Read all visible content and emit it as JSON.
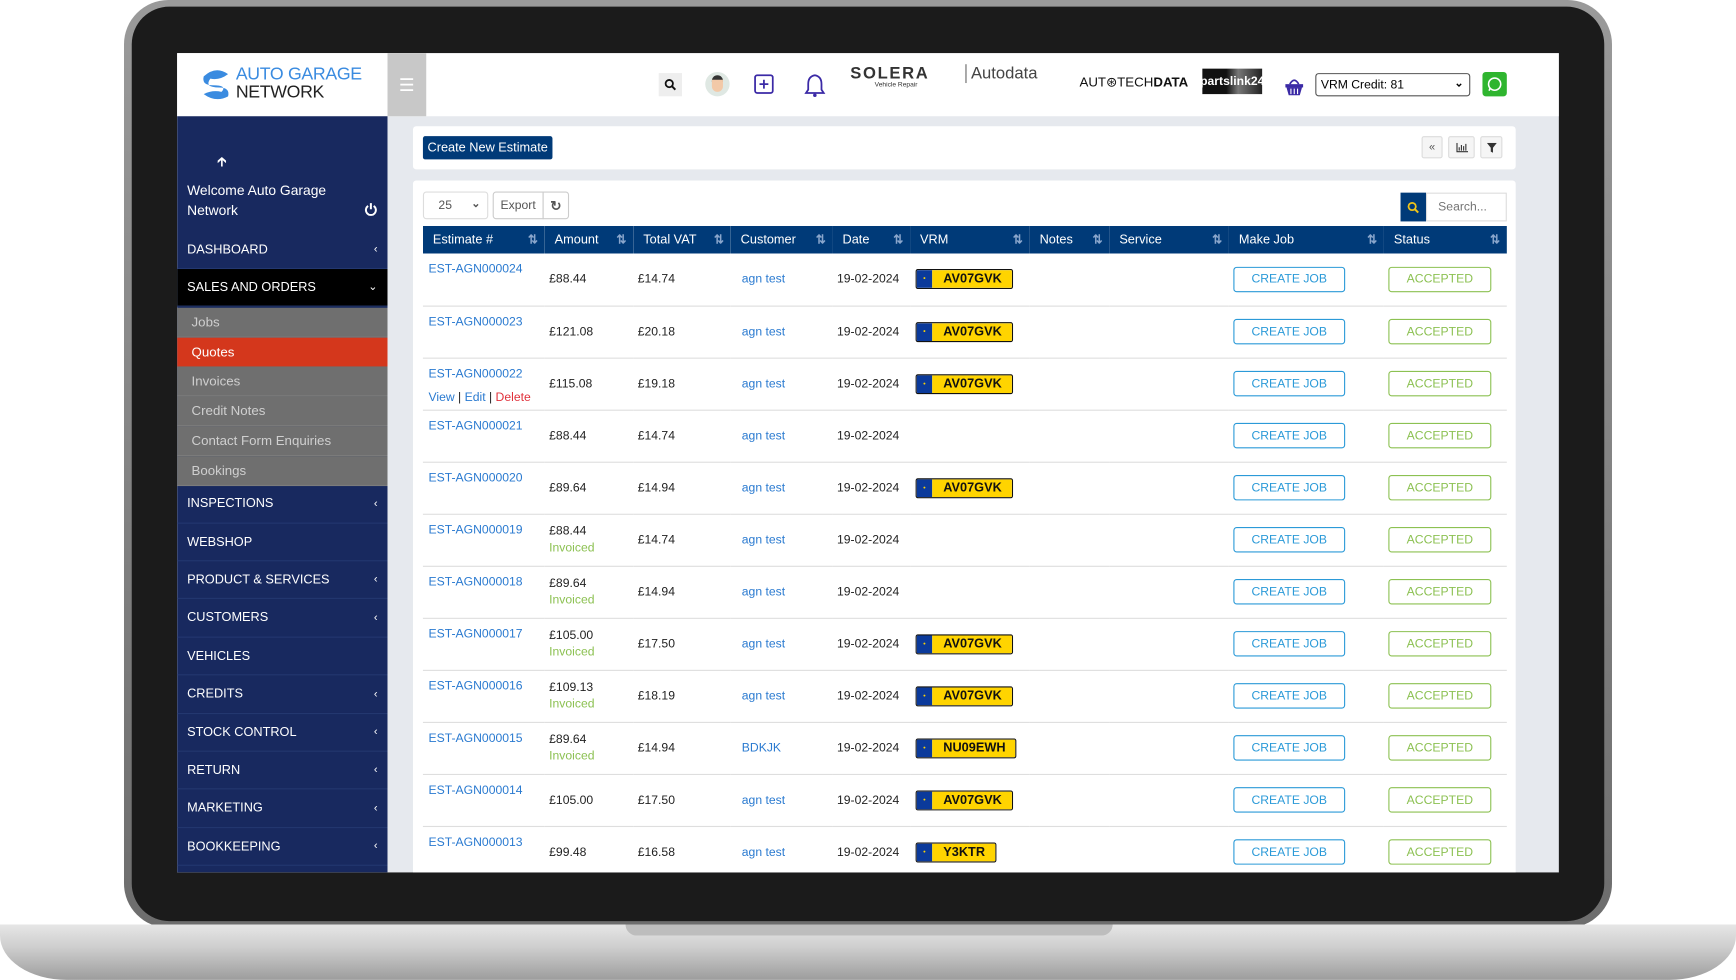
{
  "header": {
    "logo_line1": "AUTO GARAGE",
    "logo_line2": "NETWORK",
    "partners": [
      "SOLERA",
      "Vehicle Repair",
      "Autodata",
      "AUT⊛TECH",
      "DATA",
      "partslink24"
    ],
    "vrm_credit": "VRM Credit: 81",
    "icons": [
      "menu-icon",
      "search-icon",
      "avatar",
      "plus-square-icon",
      "bell-icon",
      "basket-icon",
      "whatsapp-icon"
    ],
    "colors": {
      "brand": "#003a78",
      "whatsapp": "#2fb52f"
    }
  },
  "sidebar": {
    "welcome": "Welcome Auto Garage Network",
    "items": [
      {
        "label": "DASHBOARD",
        "chevron": "‹"
      },
      {
        "label": "SALES AND ORDERS",
        "chevron": "⌄",
        "expanded": true
      },
      {
        "label": "INSPECTIONS",
        "chevron": "‹"
      },
      {
        "label": "WEBSHOP",
        "chevron": ""
      },
      {
        "label": "PRODUCT & SERVICES",
        "chevron": "‹"
      },
      {
        "label": "CUSTOMERS",
        "chevron": "‹"
      },
      {
        "label": "VEHICLES",
        "chevron": ""
      },
      {
        "label": "CREDITS",
        "chevron": "‹"
      },
      {
        "label": "STOCK CONTROL",
        "chevron": "‹"
      },
      {
        "label": "RETURN",
        "chevron": "‹"
      },
      {
        "label": "MARKETING",
        "chevron": "‹"
      },
      {
        "label": "BOOKKEEPING",
        "chevron": "‹"
      }
    ],
    "sub_items": [
      "Jobs",
      "Quotes",
      "Invoices",
      "Credit Notes",
      "Contact Form Enquiries",
      "Bookings"
    ],
    "active_sub": "Quotes",
    "active_color": "#d4371c"
  },
  "toolbar": {
    "create_label": "Create New Estimate",
    "page_size": "25",
    "export_label": "Export",
    "search_placeholder": "Search..."
  },
  "table": {
    "columns": [
      "Estimate #",
      "Amount",
      "Total VAT",
      "Customer",
      "Date",
      "VRM",
      "Notes",
      "Service",
      "Make Job",
      "Status"
    ],
    "action_labels": {
      "view": "View",
      "edit": "Edit",
      "delete": "Delete"
    },
    "rows": [
      {
        "id": "EST-AGN000024",
        "amount": "£88.44",
        "invoiced": "",
        "vat": "£14.74",
        "customer": "agn test",
        "date": "19-02-2024",
        "vrm": "AV07GVK",
        "notes": "",
        "service": "",
        "job": "CREATE JOB",
        "status": "ACCEPTED"
      },
      {
        "id": "EST-AGN000023",
        "amount": "£121.08",
        "invoiced": "",
        "vat": "£20.18",
        "customer": "agn test",
        "date": "19-02-2024",
        "vrm": "AV07GVK",
        "notes": "",
        "service": "",
        "job": "CREATE JOB",
        "status": "ACCEPTED"
      },
      {
        "id": "EST-AGN000022",
        "amount": "£115.08",
        "invoiced": "",
        "vat": "£19.18",
        "customer": "agn test",
        "date": "19-02-2024",
        "vrm": "AV07GVK",
        "notes": "",
        "service": "",
        "job": "CREATE JOB",
        "status": "ACCEPTED",
        "show_actions": true
      },
      {
        "id": "EST-AGN000021",
        "amount": "£88.44",
        "invoiced": "",
        "vat": "£14.74",
        "customer": "agn test",
        "date": "19-02-2024",
        "vrm": "",
        "notes": "",
        "service": "",
        "job": "CREATE JOB",
        "status": "ACCEPTED"
      },
      {
        "id": "EST-AGN000020",
        "amount": "£89.64",
        "invoiced": "",
        "vat": "£14.94",
        "customer": "agn test",
        "date": "19-02-2024",
        "vrm": "AV07GVK",
        "notes": "",
        "service": "",
        "job": "CREATE JOB",
        "status": "ACCEPTED"
      },
      {
        "id": "EST-AGN000019",
        "amount": "£88.44",
        "invoiced": "Invoiced",
        "vat": "£14.74",
        "customer": "agn test",
        "date": "19-02-2024",
        "vrm": "",
        "notes": "",
        "service": "",
        "job": "CREATE JOB",
        "status": "ACCEPTED"
      },
      {
        "id": "EST-AGN000018",
        "amount": "£89.64",
        "invoiced": "Invoiced",
        "vat": "£14.94",
        "customer": "agn test",
        "date": "19-02-2024",
        "vrm": "",
        "notes": "",
        "service": "",
        "job": "CREATE JOB",
        "status": "ACCEPTED"
      },
      {
        "id": "EST-AGN000017",
        "amount": "£105.00",
        "invoiced": "Invoiced",
        "vat": "£17.50",
        "customer": "agn test",
        "date": "19-02-2024",
        "vrm": "AV07GVK",
        "notes": "",
        "service": "",
        "job": "CREATE JOB",
        "status": "ACCEPTED"
      },
      {
        "id": "EST-AGN000016",
        "amount": "£109.13",
        "invoiced": "Invoiced",
        "vat": "£18.19",
        "customer": "agn test",
        "date": "19-02-2024",
        "vrm": "AV07GVK",
        "notes": "",
        "service": "",
        "job": "CREATE JOB",
        "status": "ACCEPTED"
      },
      {
        "id": "EST-AGN000015",
        "amount": "£89.64",
        "invoiced": "Invoiced",
        "vat": "£14.94",
        "customer": "BDKJK",
        "date": "19-02-2024",
        "vrm": "NU09EWH",
        "notes": "",
        "service": "",
        "job": "CREATE JOB",
        "status": "ACCEPTED"
      },
      {
        "id": "EST-AGN000014",
        "amount": "£105.00",
        "invoiced": "",
        "vat": "£17.50",
        "customer": "agn test",
        "date": "19-02-2024",
        "vrm": "AV07GVK",
        "notes": "",
        "service": "",
        "job": "CREATE JOB",
        "status": "ACCEPTED"
      },
      {
        "id": "EST-AGN000013",
        "amount": "£99.48",
        "invoiced": "",
        "vat": "£16.58",
        "customer": "agn test",
        "date": "19-02-2024",
        "vrm": "Y3KTR",
        "notes": "",
        "service": "",
        "job": "CREATE JOB",
        "status": "ACCEPTED"
      }
    ]
  }
}
